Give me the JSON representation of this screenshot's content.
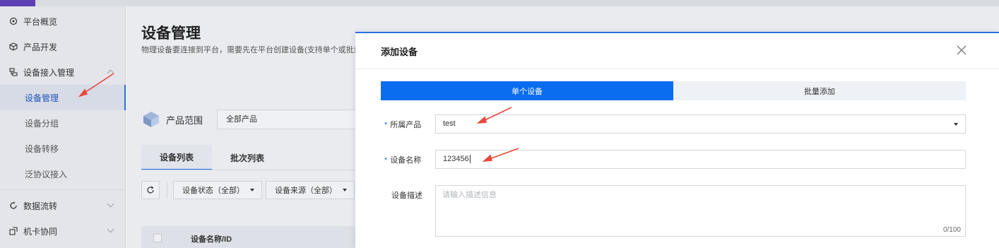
{
  "sidebar": {
    "items": [
      {
        "label": "平台概览",
        "icon": "dashboard-icon"
      },
      {
        "label": "产品开发",
        "icon": "cube-icon"
      },
      {
        "label": "设备接入管理",
        "icon": "device-access-icon"
      },
      {
        "label": "数据流转",
        "icon": "data-flow-icon"
      },
      {
        "label": "机卡协同",
        "icon": "card-sync-icon"
      }
    ],
    "sub_items": [
      {
        "label": "设备管理"
      },
      {
        "label": "设备分组"
      },
      {
        "label": "设备转移"
      },
      {
        "label": "泛协议接入"
      }
    ]
  },
  "main": {
    "title": "设备管理",
    "description": "物理设备要连接到平台，需要先在平台创建设备(支持单个或批量",
    "scope_label": "产品范围",
    "scope_value": "全部产品",
    "tabs": [
      {
        "label": "设备列表"
      },
      {
        "label": "批次列表"
      }
    ],
    "filters": [
      {
        "label": "设备状态（全部）"
      },
      {
        "label": "设备来源（全部）"
      }
    ],
    "table_header": "设备名称/ID"
  },
  "modal": {
    "title": "添加设备",
    "segments": [
      {
        "label": "单个设备"
      },
      {
        "label": "批量添加"
      }
    ],
    "fields": {
      "product_label": "所属产品",
      "product_value": "test",
      "name_label": "设备名称",
      "name_value": "123456",
      "desc_label": "设备描述",
      "desc_placeholder": "请输入描述信息",
      "desc_count": "0/100"
    },
    "required_mark": "*"
  },
  "colors": {
    "accent": "#0a6df0",
    "annotation_arrow": "#e8483d",
    "brand": "#5b3fb3"
  }
}
